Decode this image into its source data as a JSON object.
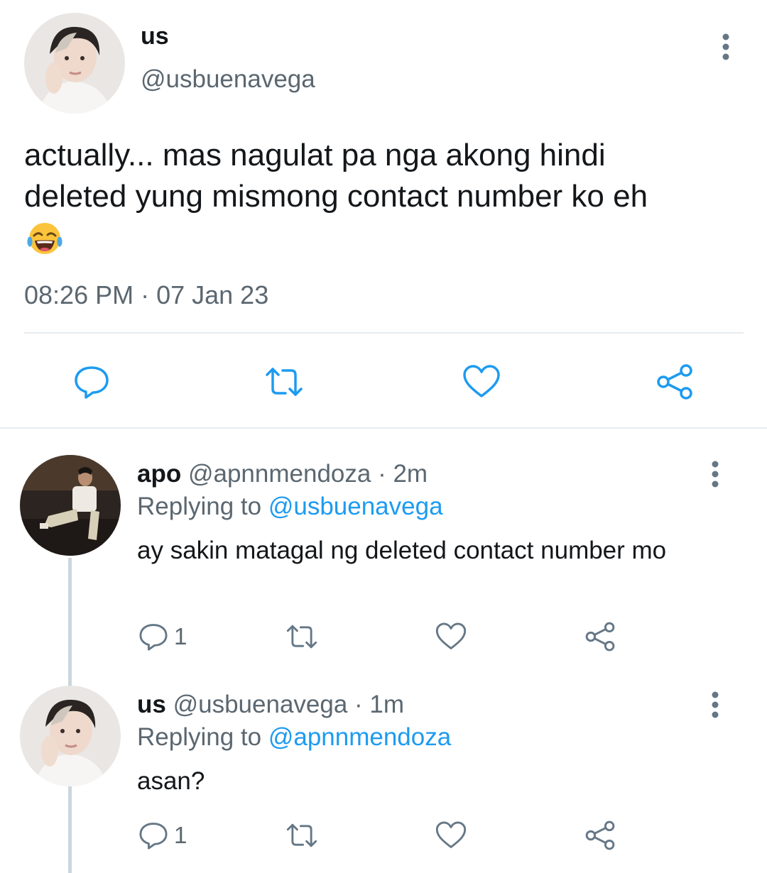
{
  "main_tweet": {
    "display_name": "us",
    "handle": "@usbuenavega",
    "text_line1": "actually... mas nagulat pa nga akong hindi",
    "text_line2": "deleted yung mismong contact number ko eh",
    "emoji": "face-with-tears-of-joy-emoji",
    "timestamp": "08:26 PM · 07 Jan 23",
    "actions": [
      "reply-icon",
      "retweet-icon",
      "like-icon",
      "share-icon"
    ]
  },
  "replies": [
    {
      "display_name": "apo",
      "handle": "@apnnmendoza",
      "time": "· 2m",
      "replying_prefix": "Replying to ",
      "replying_to": "@usbuenavega",
      "text": "ay sakin matagal ng deleted contact number mo",
      "reply_count": "1"
    },
    {
      "display_name": "us",
      "handle": "@usbuenavega",
      "time": "· 1m",
      "replying_prefix": "Replying to ",
      "replying_to": "@apnnmendoza",
      "text": "asan?",
      "reply_count": "1"
    }
  ],
  "colors": {
    "text": "#14171a",
    "secondary": "#5b6770",
    "link": "#1d9bf0",
    "divider": "#e6ecf0",
    "thread_line": "#ccd6dd"
  }
}
